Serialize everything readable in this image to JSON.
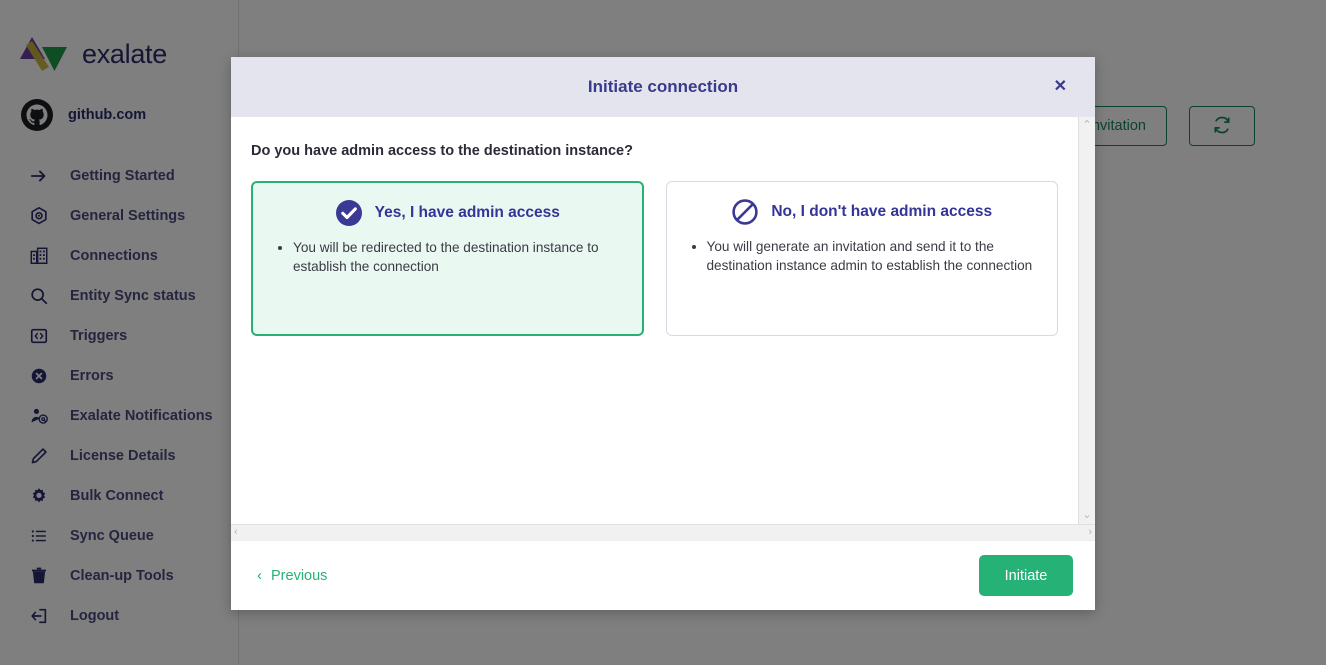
{
  "sidebar": {
    "brand": "exalate",
    "brand_logo_icon": "exalate-triangle-logo",
    "instance": {
      "icon": "github-icon",
      "name": "github.com"
    },
    "items": [
      {
        "label": "Getting Started",
        "icon": "arrow-right-icon"
      },
      {
        "label": "General Settings",
        "icon": "hexagon-gear-icon"
      },
      {
        "label": "Connections",
        "icon": "buildings-icon"
      },
      {
        "label": "Entity Sync status",
        "icon": "search-icon"
      },
      {
        "label": "Triggers",
        "icon": "code-brackets-icon"
      },
      {
        "label": "Errors",
        "icon": "error-x-circle-icon"
      },
      {
        "label": "Exalate Notifications",
        "icon": "person-at-icon"
      },
      {
        "label": "License Details",
        "icon": "pencil-icon"
      },
      {
        "label": "Bulk Connect",
        "icon": "gear-icon"
      },
      {
        "label": "Sync Queue",
        "icon": "list-icon"
      },
      {
        "label": "Clean-up Tools",
        "icon": "trash-icon"
      },
      {
        "label": "Logout",
        "icon": "logout-icon"
      }
    ]
  },
  "background_toolbar": {
    "accept_invitation_label": "Accept invitation",
    "refresh_icon": "refresh-icon"
  },
  "modal": {
    "title": "Initiate connection",
    "close_icon": "close-icon",
    "question": "Do you have admin access to the destination instance?",
    "options": [
      {
        "id": "yes",
        "icon": "check-circle-icon",
        "title": "Yes, I have admin access",
        "selected": true,
        "bullets": [
          "You will be redirected to the destination instance to establish the connection"
        ]
      },
      {
        "id": "no",
        "icon": "no-entry-icon",
        "title": "No, I don't have admin access",
        "selected": false,
        "bullets": [
          "You will generate an invitation and send it to the destination instance admin to establish the connection"
        ]
      }
    ],
    "scrollbars": {
      "up_arrow": "⌃",
      "down_arrow": "⌄",
      "left_arrow": "‹",
      "right_arrow": "›"
    },
    "footer": {
      "previous_label": "Previous",
      "previous_chevron": "‹",
      "initiate_label": "Initiate"
    }
  },
  "colors": {
    "accent_green": "#26b277",
    "outline_green": "#19875a",
    "brand_indigo": "#2b2a6b",
    "title_indigo": "#3a3a8c",
    "card_selected_bg": "#e9f8f0",
    "modal_header_bg": "#e4e4ef"
  }
}
